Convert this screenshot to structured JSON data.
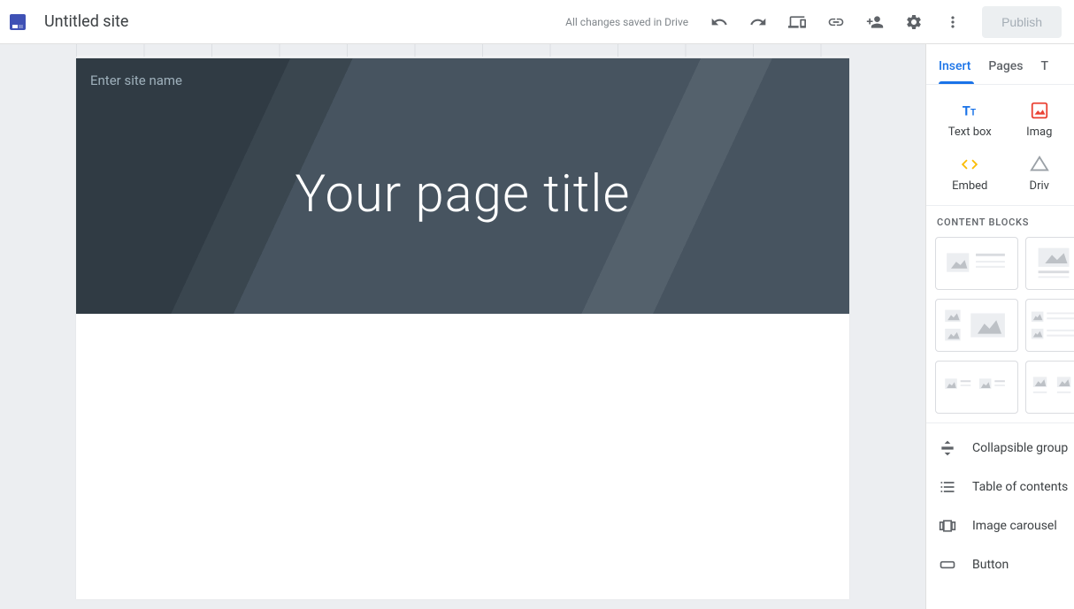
{
  "header": {
    "site_title": "Untitled site",
    "save_status": "All changes saved in Drive",
    "publish_label": "Publish"
  },
  "canvas": {
    "site_name_placeholder": "Enter site name",
    "page_title": "Your page title"
  },
  "sidepanel": {
    "tabs": {
      "insert": "Insert",
      "pages": "Pages",
      "themes_initial": "T"
    },
    "insert_items": {
      "text_box": "Text box",
      "images_partial": "Imag",
      "embed": "Embed",
      "drive_partial": "Driv"
    },
    "blocks_header": "CONTENT BLOCKS",
    "components": {
      "collapsible": "Collapsible group",
      "toc": "Table of contents",
      "carousel": "Image carousel",
      "button": "Button"
    }
  },
  "icons": {
    "undo": "undo-icon",
    "redo": "redo-icon",
    "preview": "preview-icon",
    "link": "link-icon",
    "share": "share-icon",
    "settings": "settings-icon",
    "more": "more-icon"
  }
}
